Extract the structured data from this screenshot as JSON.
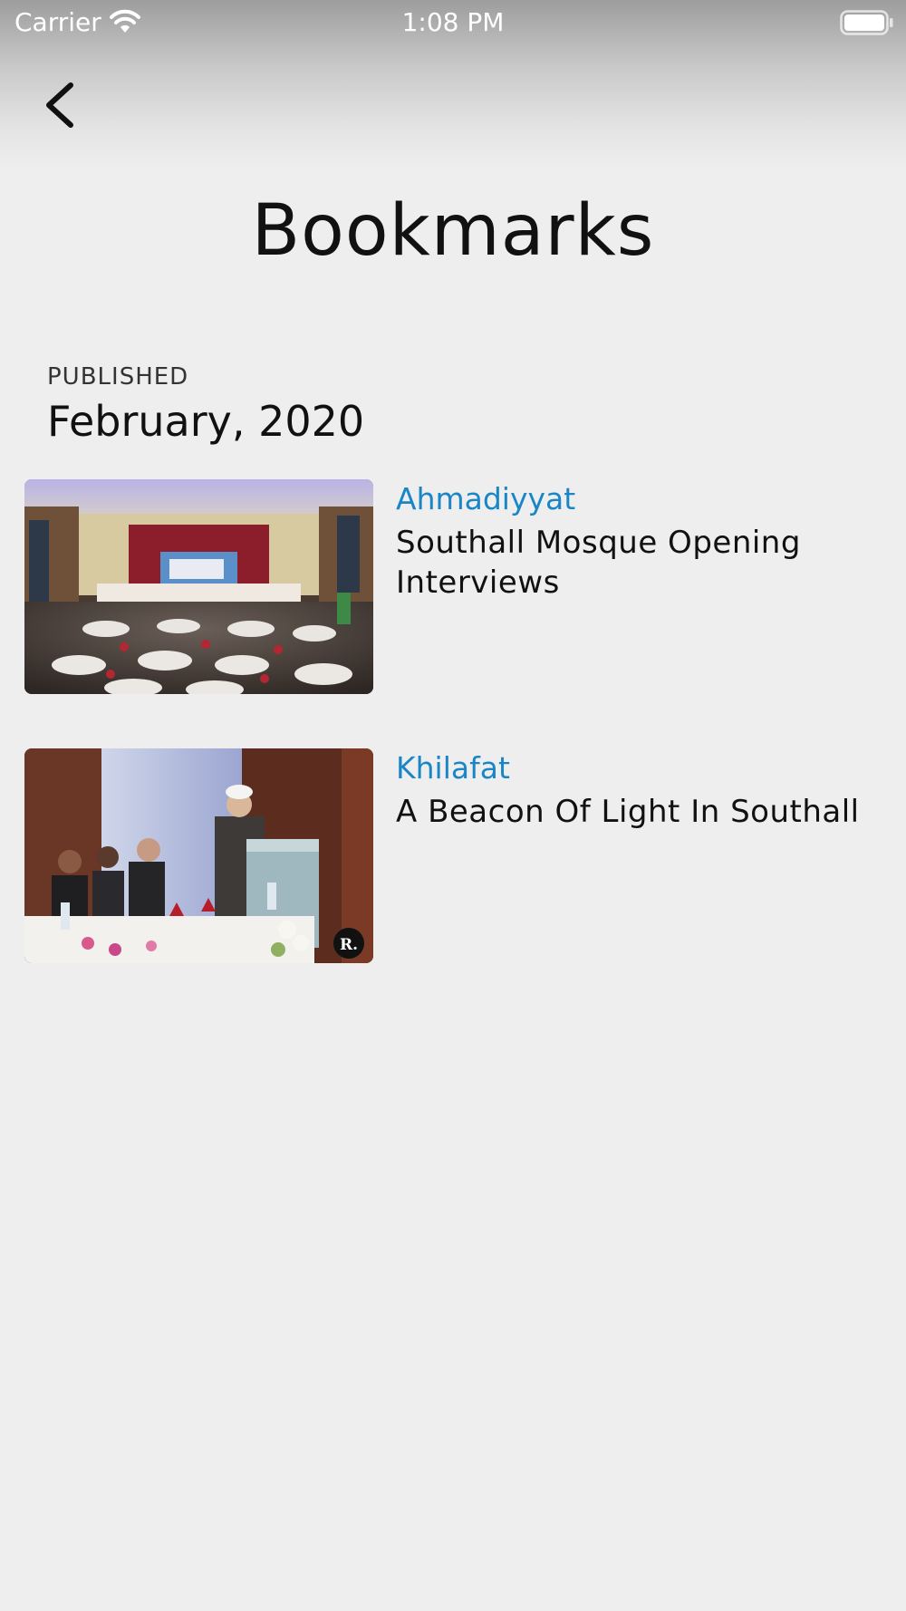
{
  "status_bar": {
    "carrier": "Carrier",
    "time": "1:08 PM"
  },
  "nav": {
    "back_icon": "chevron-left-icon"
  },
  "page": {
    "title": "Bookmarks"
  },
  "section": {
    "caption": "PUBLISHED",
    "date": "February, 2020"
  },
  "bookmarks": [
    {
      "category": "Ahmadiyyat",
      "title": "Southall Mosque Opening Interviews"
    },
    {
      "category": "Khilafat",
      "title": "A Beacon Of Light In Southall"
    }
  ],
  "colors": {
    "category_accent": "#1b86c6",
    "background": "#eeeeef"
  }
}
